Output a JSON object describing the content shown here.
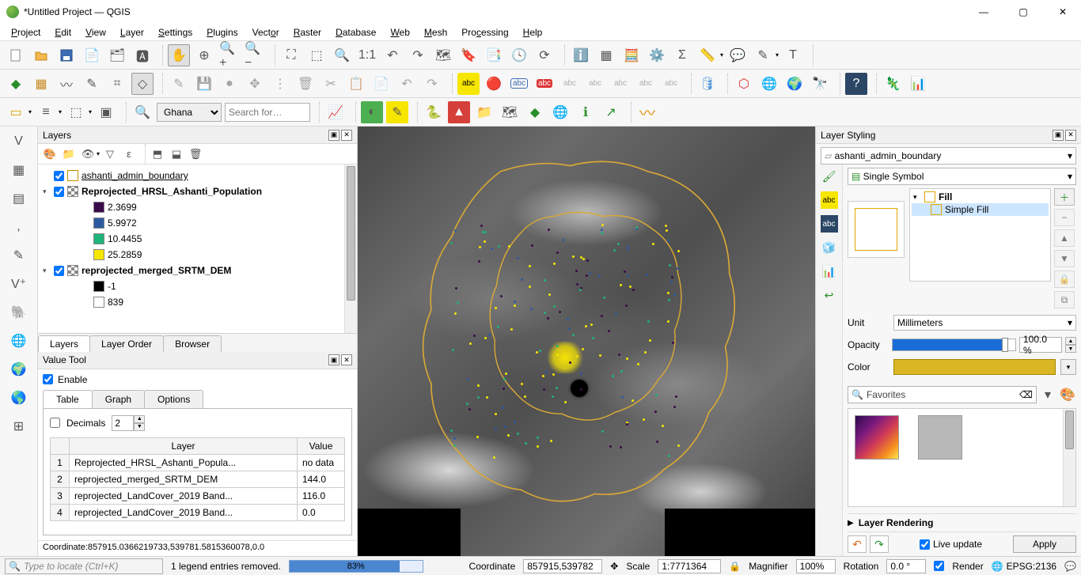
{
  "title": "*Untitled Project — QGIS",
  "menu": [
    "Project",
    "Edit",
    "View",
    "Layer",
    "Settings",
    "Plugins",
    "Vector",
    "Raster",
    "Database",
    "Web",
    "Mesh",
    "Processing",
    "Help"
  ],
  "toolbar3": {
    "geocoder_value": "Ghana",
    "search_placeholder": "Search for…"
  },
  "layers_panel": {
    "title": "Layers",
    "tabs": [
      "Layers",
      "Layer Order",
      "Browser"
    ],
    "active_tab": 0,
    "items": [
      {
        "indent": 0,
        "checked": true,
        "tri": "",
        "name": "ashanti_admin_boundary",
        "swatch": "outline:#c58f00",
        "underline": true
      },
      {
        "indent": 0,
        "checked": true,
        "tri": "▾",
        "name": "Reprojected_HRSL_Ashanti_Population",
        "swatch": "checker",
        "bold": true
      },
      {
        "indent": 2,
        "swatch": "#3b0a4a",
        "name": "2.3699"
      },
      {
        "indent": 2,
        "swatch": "#2c5aa0",
        "name": "5.9972"
      },
      {
        "indent": 2,
        "swatch": "#1fb47a",
        "name": "10.4455"
      },
      {
        "indent": 2,
        "swatch": "#f7e600",
        "name": "25.2859"
      },
      {
        "indent": 0,
        "checked": true,
        "tri": "▾",
        "name": "reprojected_merged_SRTM_DEM",
        "swatch": "checker",
        "bold": true
      },
      {
        "indent": 2,
        "swatch": "#000000",
        "name": "-1"
      },
      {
        "indent": 2,
        "swatch": "#ffffff",
        "name": "839"
      }
    ]
  },
  "value_tool": {
    "title": "Value Tool",
    "enable_label": "Enable",
    "enable_checked": true,
    "tabs": [
      "Table",
      "Graph",
      "Options"
    ],
    "active_tab": 0,
    "decimals_label": "Decimals",
    "decimals_value": "2",
    "columns": [
      "",
      "Layer",
      "Value"
    ],
    "rows": [
      [
        "1",
        "Reprojected_HRSL_Ashanti_Popula...",
        "no data"
      ],
      [
        "2",
        "reprojected_merged_SRTM_DEM",
        "144.0"
      ],
      [
        "3",
        "reprojected_LandCover_2019 Band...",
        "116.0"
      ],
      [
        "4",
        "reprojected_LandCover_2019 Band...",
        "0.0"
      ]
    ],
    "coord_line": "Coordinate:857915.0366219733,539781.5815360078,0.0"
  },
  "layer_styling": {
    "title": "Layer Styling",
    "layer_select": "ashanti_admin_boundary",
    "symbol_mode": "Single Symbol",
    "tree": [
      {
        "indent": 0,
        "tri": "▾",
        "swatch": "outline:#e2a500",
        "label": "Fill"
      },
      {
        "indent": 1,
        "swatch": "outline:#e2a500",
        "label": "Simple Fill",
        "selected": true
      }
    ],
    "unit_label": "Unit",
    "unit_value": "Millimeters",
    "opacity_label": "Opacity",
    "opacity_value": "100.0 %",
    "color_label": "Color",
    "color_value": "#dab524",
    "favorites_placeholder": "Favorites",
    "rendering_label": "Layer Rendering",
    "live_update_label": "Live update",
    "live_update_checked": true,
    "apply_label": "Apply"
  },
  "statusbar": {
    "locator_placeholder": "Type to locate (Ctrl+K)",
    "legend_msg": "1 legend entries removed.",
    "progress_pct": 83,
    "progress_text": "83%",
    "coord_label": "Coordinate",
    "coord_value": "857915,539782",
    "scale_label": "Scale",
    "scale_value": "1:7771364",
    "magnifier_label": "Magnifier",
    "magnifier_value": "100%",
    "rotation_label": "Rotation",
    "rotation_value": "0.0 °",
    "render_label": "Render",
    "render_checked": true,
    "crs_label": "EPSG:2136"
  }
}
